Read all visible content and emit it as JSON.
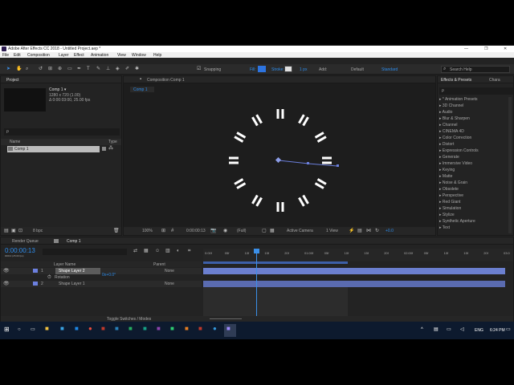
{
  "window": {
    "title": "Adobe After Effects CC 2018 - Untitled Project.aep *"
  },
  "menu": [
    "File",
    "Edit",
    "Composition",
    "Layer",
    "Effect",
    "Animation",
    "View",
    "Window",
    "Help"
  ],
  "toolbar": {
    "snapping": "Snapping",
    "fill": "Fill:",
    "stroke": "Stroke:",
    "stroke_width": "1 px",
    "add": "Add:",
    "workspace_default": "Default",
    "workspace_standard": "Standard",
    "search_placeholder": "Search Help"
  },
  "project": {
    "tab": "Project",
    "comp_name": "Comp 1 ▾",
    "comp_info1": "1280 x 720 (1.00)",
    "comp_info2": "Δ 0:00:03:00, 25.00 fps",
    "search_placeholder": "ρ",
    "col_name": "Name",
    "col_type": "Type",
    "item": "Comp 1",
    "bpc": "8 bpc"
  },
  "composition": {
    "tab": "Composition Comp 1",
    "subtab": "Comp 1",
    "zoom": "100%",
    "timecode": "0:00:00:13",
    "resolution": "(Full)",
    "camera": "Active Camera",
    "views": "1 View",
    "exposure": "+0.0"
  },
  "effects": {
    "tab": "Effects & Presets",
    "tab2": "Chara",
    "search_placeholder": "ρ",
    "items": [
      "* Animation Presets",
      "3D Channel",
      "Audio",
      "Blur & Sharpen",
      "Channel",
      "CINEMA 4D",
      "Color Correction",
      "Distort",
      "Expression Controls",
      "Generate",
      "Immersive Video",
      "Keying",
      "Matte",
      "Noise & Grain",
      "Obsolete",
      "Perspective",
      "Red Giant",
      "Simulation",
      "Stylize",
      "Synthetic Aperture",
      "Text"
    ]
  },
  "timeline": {
    "tab_render": "Render Queue",
    "tab_comp": "Comp 1",
    "timecode": "0:00:00:13",
    "timecode_sub": "00013 (25.00 fps)",
    "col_layer": "Layer Name",
    "col_parent": "Parent",
    "layers": [
      {
        "num": "1",
        "name": "Shape Layer 2",
        "parent": "None"
      },
      {
        "num": "2",
        "name": "Shape Layer 1",
        "parent": "None"
      }
    ],
    "rotation_label": "Rotation",
    "rotation_value": "0x+0.0°",
    "ruler": [
      "0:00f",
      "05f",
      "10f",
      "15f",
      "20f",
      "01:00f",
      "05f",
      "10f",
      "15f",
      "20f",
      "02:00f",
      "05f",
      "10f",
      "15f",
      "20f",
      "03:0"
    ],
    "toggle": "Toggle Switches / Modes"
  },
  "taskbar": {
    "lang": "ENG",
    "time": "6:24 PM"
  }
}
